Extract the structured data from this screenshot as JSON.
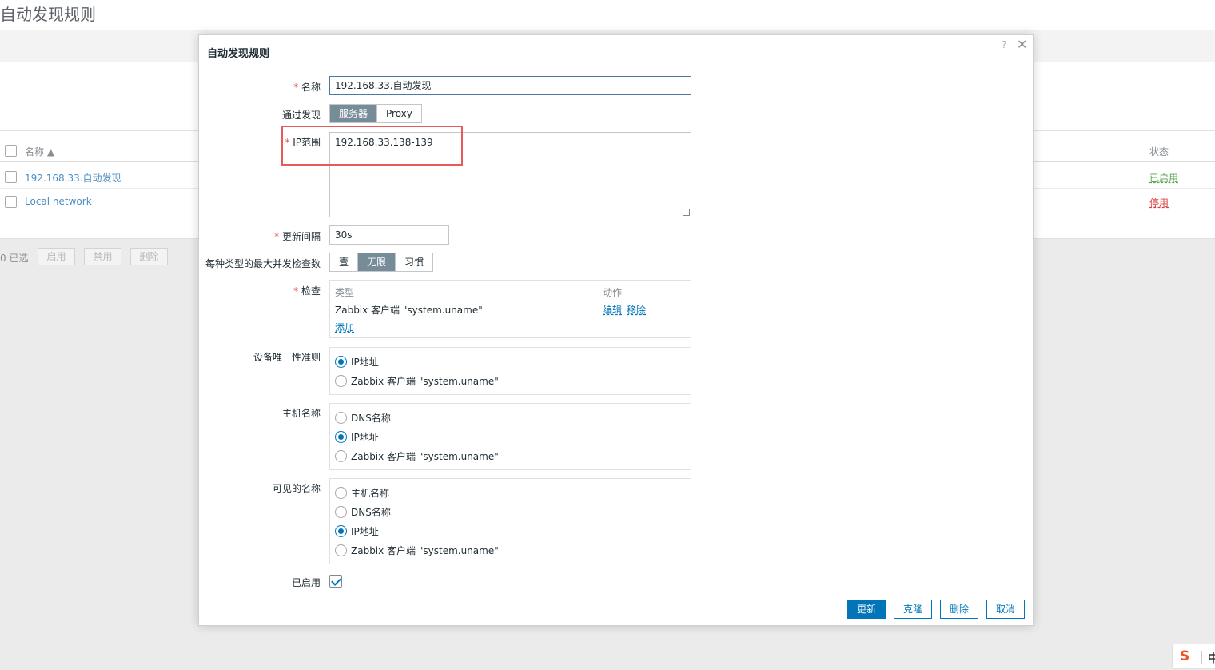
{
  "page": {
    "title": "自动发现规则",
    "table": {
      "header": {
        "name": "名称 ▲",
        "status": "状态"
      },
      "rows": [
        {
          "name": "192.168.33.自动发现",
          "status": "已启用"
        },
        {
          "name": "Local network",
          "status": "停用"
        }
      ]
    },
    "bulk": {
      "count": "0 已选",
      "enable": "启用",
      "disable": "禁用",
      "delete": "删除"
    }
  },
  "dialog": {
    "title": "自动发现规则",
    "help": "?",
    "close": "✕",
    "name_label": "名称",
    "name_value": "192.168.33.自动发现",
    "discovery_by_label": "通过发现",
    "discovery_by_options": [
      "服务器",
      "Proxy"
    ],
    "iprange_label": "IP范围",
    "iprange_value": "192.168.33.138-139",
    "interval_label": "更新间隔",
    "interval_value": "30s",
    "concurrency_label": "每种类型的最大并发检查数",
    "concurrency_options": [
      "壹",
      "无限",
      "习惯"
    ],
    "checks_label": "检查",
    "checks": {
      "col_type": "类型",
      "col_action": "动作",
      "row_type": "Zabbix 客户端 \"system.uname\"",
      "edit": "编辑",
      "remove": "移除",
      "add": "添加"
    },
    "uniqueness_label": "设备唯一性准则",
    "uniqueness_options": [
      "IP地址",
      "Zabbix 客户端 \"system.uname\""
    ],
    "hostname_label": "主机名称",
    "hostname_options": [
      "DNS名称",
      "IP地址",
      "Zabbix 客户端 \"system.uname\""
    ],
    "visiblename_label": "可见的名称",
    "visiblename_options": [
      "主机名称",
      "DNS名称",
      "IP地址",
      "Zabbix 客户端 \"system.uname\""
    ],
    "enabled_label": "已启用",
    "buttons": {
      "update": "更新",
      "clone": "克隆",
      "delete": "删除",
      "cancel": "取消"
    }
  },
  "ime": {
    "logo": "S",
    "lang": "中"
  },
  "colors": {
    "accent": "#0275b8",
    "segment_active": "#768d99",
    "required": "#e45959",
    "highlight": "#e85a5a",
    "enabled": "#59a34f",
    "disabled": "#d64541"
  }
}
